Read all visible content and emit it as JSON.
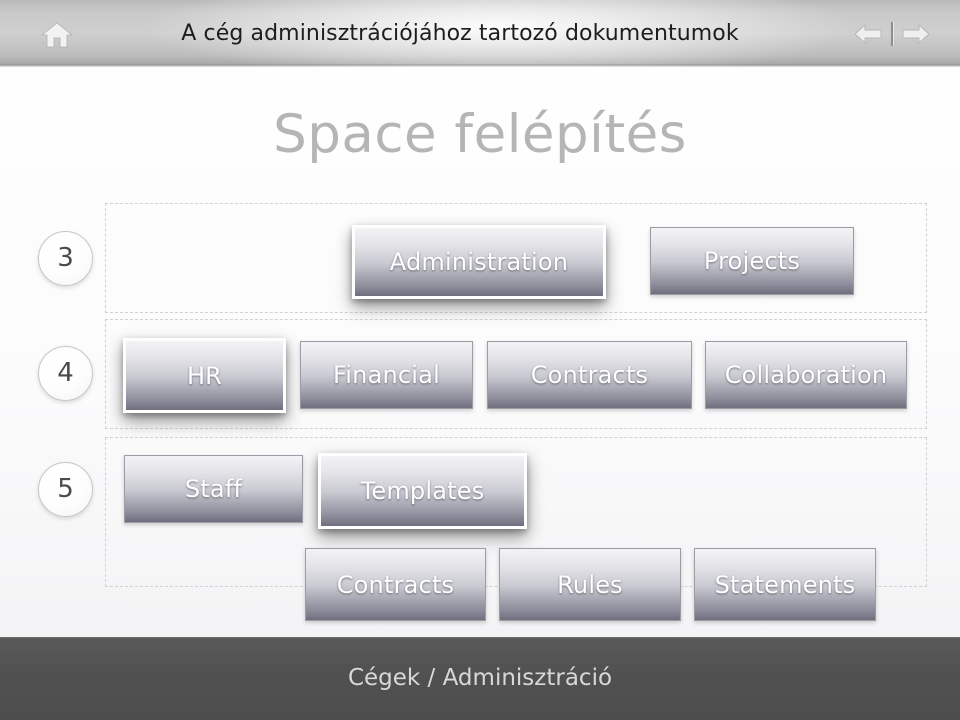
{
  "header": {
    "title": "A cég adminisztrációjához tartozó dokumentumok",
    "home_icon": "home-icon",
    "prev_icon": "arrow-left-icon",
    "next_icon": "arrow-right-icon"
  },
  "slide": {
    "title": "Space felépítés"
  },
  "badges": [
    {
      "label": "3"
    },
    {
      "label": "4"
    },
    {
      "label": "5"
    }
  ],
  "nodes": {
    "row3": [
      {
        "label": "Administration",
        "highlight": true
      },
      {
        "label": "Projects",
        "highlight": false
      }
    ],
    "row4": [
      {
        "label": "HR",
        "highlight": true
      },
      {
        "label": "Financial",
        "highlight": false
      },
      {
        "label": "Contracts",
        "highlight": false
      },
      {
        "label": "Collaboration",
        "highlight": false
      }
    ],
    "row5": [
      {
        "label": "Staff",
        "highlight": false
      },
      {
        "label": "Templates",
        "highlight": true
      }
    ],
    "row5b": [
      {
        "label": "Contracts",
        "highlight": false
      },
      {
        "label": "Rules",
        "highlight": false
      },
      {
        "label": "Statements",
        "highlight": false
      }
    ]
  },
  "footer": {
    "text": "Cégek / Adminisztráció"
  },
  "colors": {
    "header_band": "#cfcfcf",
    "footer_band": "#515151",
    "title_gray": "#b4b5b6",
    "node_top": "#f3f3f6",
    "node_bottom": "#6e6e7d",
    "dash_border": "#d2d2d4"
  }
}
